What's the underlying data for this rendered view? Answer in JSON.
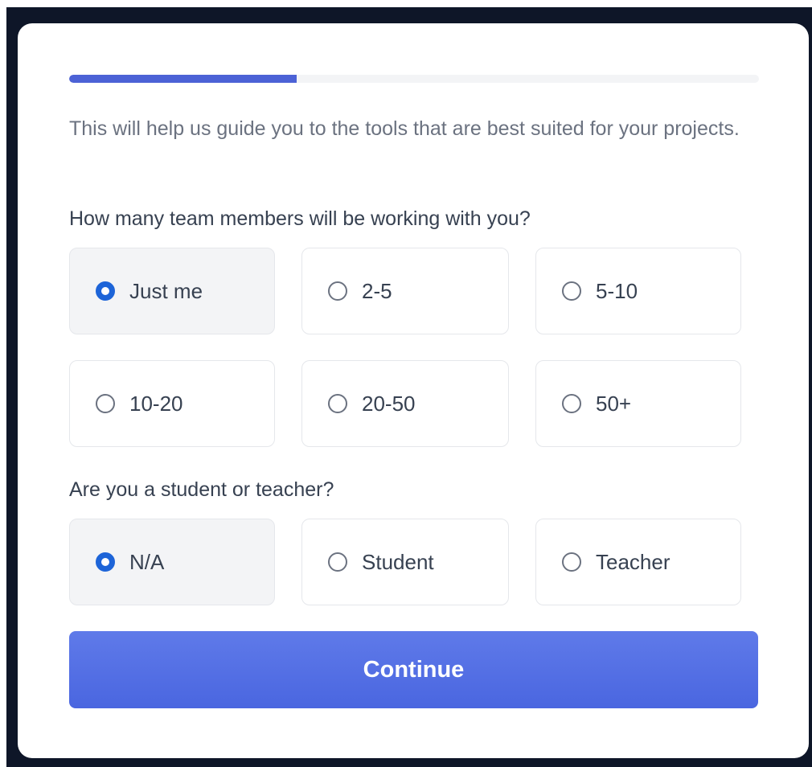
{
  "progress": {
    "fraction": 0.33,
    "fill_color": "#4c62d6"
  },
  "intro": {
    "text": "This will help us guide you to the tools that are best suited for your projects."
  },
  "team_size": {
    "question": "How many team members will be working with you?",
    "options": [
      {
        "label": "Just me",
        "selected": true
      },
      {
        "label": "2-5",
        "selected": false
      },
      {
        "label": "5-10",
        "selected": false
      },
      {
        "label": "10-20",
        "selected": false
      },
      {
        "label": "20-50",
        "selected": false
      },
      {
        "label": "50+",
        "selected": false
      }
    ]
  },
  "role": {
    "question": "Are you a student or teacher?",
    "options": [
      {
        "label": "N/A",
        "selected": true
      },
      {
        "label": "Student",
        "selected": false
      },
      {
        "label": "Teacher",
        "selected": false
      }
    ]
  },
  "continue_button": {
    "label": "Continue",
    "color": "#5470e4"
  },
  "colors": {
    "radio_selected": "#1d64d8",
    "selected_option_bg": "#f3f4f6",
    "backdrop": "#0e1628"
  }
}
